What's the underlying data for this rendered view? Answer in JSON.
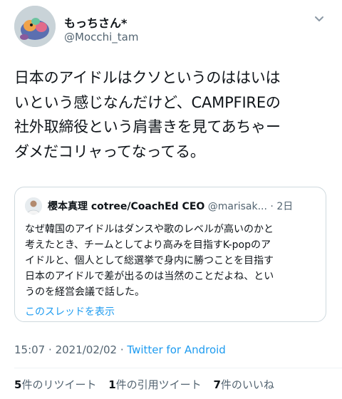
{
  "author": {
    "display_name": "もっちさん*",
    "handle": "@Mocchi_tam",
    "avatar_icon": "plush-toy-avatar-icon"
  },
  "tweet": {
    "text": "日本のアイドルはクソというのははいは\nいという感じなんだけど、CAMPFIREの\n社外取締役という肩書きを見てあちゃー\nダメだコリャってなってる。"
  },
  "quote": {
    "name": "櫻本真理 cotree/CoachEd CEO",
    "handle": "@marisak...",
    "separator": "·",
    "time": "2日",
    "text": "なぜ韓国のアイドルはダンスや歌のレベルが高いのかと\n考えたとき、チームとしてより高みを目指すK-popのア\nイドルと、個人として総選挙で身内に勝つことを目指す\n日本のアイドルで差が出るのは当然のことだよね、とい\nうのを経営会議で話した。",
    "show_thread": "このスレッドを表示"
  },
  "meta": {
    "time": "15:07",
    "date": "2021/02/02",
    "separator": "·",
    "source": "Twitter for Android"
  },
  "stats": {
    "retweets_count": "5",
    "retweets_label": "件のリツイート",
    "quotes_count": "1",
    "quotes_label": "件の引用ツイート",
    "likes_count": "7",
    "likes_label": "件のいいね"
  }
}
